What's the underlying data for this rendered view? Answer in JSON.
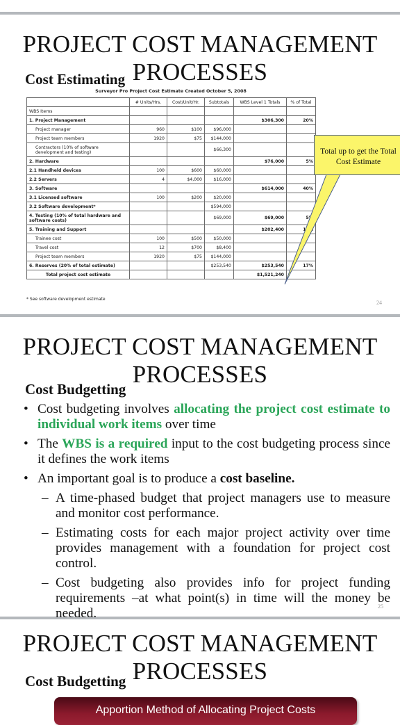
{
  "slides": [
    {
      "title_line1": "PROJECT COST MANAGEMENT",
      "title_line2": "PROCESSES",
      "subheading": "Cost Estimating",
      "page_number": "24",
      "table": {
        "caption": "Surveyor Pro Project Cost Estimate Created October 5, 2008",
        "headers": [
          "",
          "# Units/Hrs.",
          "Cost/Unit/Hr.",
          "Subtotals",
          "WBS Level 1 Totals",
          "% of Total"
        ],
        "rows": [
          [
            "WBS Items",
            "",
            "",
            "",
            "",
            ""
          ],
          [
            "1. Project Management",
            "",
            "",
            "",
            "$306,300",
            "20%"
          ],
          [
            "Project manager",
            "960",
            "$100",
            "$96,000",
            "",
            ""
          ],
          [
            "Project team members",
            "1920",
            "$75",
            "$144,000",
            "",
            ""
          ],
          [
            "Contractors (10% of software development and testing)",
            "",
            "",
            "$66,300",
            "",
            ""
          ],
          [
            "2. Hardware",
            "",
            "",
            "",
            "$76,000",
            "5%"
          ],
          [
            "2.1  Handheld devices",
            "100",
            "$600",
            "$60,000",
            "",
            ""
          ],
          [
            "2.2  Servers",
            "4",
            "$4,000",
            "$16,000",
            "",
            ""
          ],
          [
            "3. Software",
            "",
            "",
            "",
            "$614,000",
            "40%"
          ],
          [
            "3.1 Licensed software",
            "100",
            "$200",
            "$20,000",
            "",
            ""
          ],
          [
            "3.2 Software development*",
            "",
            "",
            "$594,000",
            "",
            ""
          ],
          [
            "4. Testing (10% of total hardware and software costs)",
            "",
            "",
            "$69,000",
            "$69,000",
            "5%"
          ],
          [
            "5. Training and Support",
            "",
            "",
            "",
            "$202,400",
            "13%"
          ],
          [
            "Trainee cost",
            "100",
            "$500",
            "$50,000",
            "",
            ""
          ],
          [
            "Travel cost",
            "12",
            "$700",
            "$8,400",
            "",
            ""
          ],
          [
            "Project team members",
            "1920",
            "$75",
            "$144,000",
            "",
            ""
          ],
          [
            "6. Reserves (20% of total estimate)",
            "",
            "",
            "$253,540",
            "$253,540",
            "17%"
          ],
          [
            "Total project cost estimate",
            "",
            "",
            "",
            "$1,521,240",
            ""
          ]
        ],
        "footnote": "* See software development estimate"
      },
      "callout": {
        "line1": "Total up to get the Total",
        "line2": "Cost Estimate",
        "fill_color": "#fbf56a"
      }
    },
    {
      "title_line1": "PROJECT COST MANAGEMENT",
      "title_line2": "PROCESSES",
      "subheading": "Cost Budgetting",
      "page_number": "25",
      "bullets": [
        {
          "parts": [
            {
              "text": "Cost budgeting involves ",
              "style": "normal"
            },
            {
              "text": "allocating the project cost estimate to individual work items",
              "style": "green"
            },
            {
              "text": " over time",
              "style": "normal"
            }
          ]
        },
        {
          "parts": [
            {
              "text": "The ",
              "style": "normal"
            },
            {
              "text": "WBS is a required",
              "style": "green"
            },
            {
              "text": " input to the cost budgeting process since it defines the work items",
              "style": "normal"
            }
          ]
        },
        {
          "parts": [
            {
              "text": "An important goal is to produce a ",
              "style": "normal"
            },
            {
              "text": "cost baseline.",
              "style": "bold"
            }
          ],
          "sub": [
            "A time-phased budget that project managers use to measure and monitor cost performance.",
            "Estimating costs for each major project activity over time provides management with a foundation for project cost control.",
            "Cost budgeting also provides info for project funding requirements –at what point(s) in time will the money be needed."
          ]
        }
      ],
      "accent_color": "#2aa558"
    },
    {
      "title_line1": "PROJECT COST MANAGEMENT",
      "title_line2": "PROCESSES",
      "subheading": "Cost Budgetting",
      "banner": "Apportion Method of Allocating Project Costs",
      "banner_color": "#8c1a2c"
    }
  ]
}
